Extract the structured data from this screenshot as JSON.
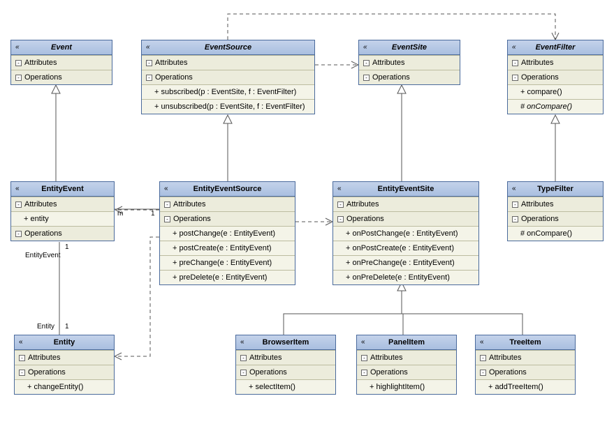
{
  "labels": {
    "attributes": "Attributes",
    "operations": "Operations"
  },
  "classes": {
    "event": {
      "name": "Event",
      "abstract": true
    },
    "eventSource": {
      "name": "EventSource",
      "abstract": true,
      "ops": [
        "+ subscribed(p : EventSite, f : EventFilter)",
        "+ unsubscribed(p : EventSite, f : EventFilter)"
      ]
    },
    "eventSite": {
      "name": "EventSite",
      "abstract": true
    },
    "eventFilter": {
      "name": "EventFilter",
      "abstract": true,
      "ops": [
        "+ compare()",
        "# onCompare()"
      ]
    },
    "entityEvent": {
      "name": "EntityEvent",
      "attrs": [
        "+ entity"
      ]
    },
    "entityEventSource": {
      "name": "EntityEventSource",
      "ops": [
        "+ postChange(e : EntityEvent)",
        "+ postCreate(e : EntityEvent)",
        "+ preChange(e : EntityEvent)",
        "+ preDelete(e : EntityEvent)"
      ]
    },
    "entityEventSite": {
      "name": "EntityEventSite",
      "ops": [
        "+ onPostChange(e : EntityEvent)",
        "+ onPostCreate(e : EntityEvent)",
        "+ onPreChange(e : EntityEvent)",
        "+ onPreDelete(e : EntityEvent)"
      ]
    },
    "typeFilter": {
      "name": "TypeFilter",
      "ops": [
        "# onCompare()"
      ]
    },
    "entity": {
      "name": "Entity",
      "ops": [
        "+ changeEntity()"
      ]
    },
    "browserItem": {
      "name": "BrowserItem",
      "ops": [
        "+ selectItem()"
      ]
    },
    "panelItem": {
      "name": "PanelItem",
      "ops": [
        "+ highlightItem()"
      ]
    },
    "treeItem": {
      "name": "TreeItem",
      "ops": [
        "+ addTreeItem()"
      ]
    }
  },
  "associations": {
    "entityevent_entity": {
      "end1_role": "EntityEvent",
      "end1_mult": "1",
      "end2_role": "Entity",
      "end2_mult": "1"
    },
    "entityevent_source": {
      "end1_mult": "m",
      "end2_mult": "1"
    }
  },
  "relationships": [
    {
      "from": "EntityEvent",
      "to": "Event",
      "kind": "generalization"
    },
    {
      "from": "EntityEventSource",
      "to": "EventSource",
      "kind": "generalization"
    },
    {
      "from": "EntityEventSite",
      "to": "EventSite",
      "kind": "generalization"
    },
    {
      "from": "TypeFilter",
      "to": "EventFilter",
      "kind": "generalization"
    },
    {
      "from": "BrowserItem",
      "to": "EntityEventSite",
      "kind": "generalization"
    },
    {
      "from": "PanelItem",
      "to": "EntityEventSite",
      "kind": "generalization"
    },
    {
      "from": "TreeItem",
      "to": "EntityEventSite",
      "kind": "generalization"
    },
    {
      "from": "EventSource",
      "to": "EventSite",
      "kind": "dependency"
    },
    {
      "from": "EventSource",
      "to": "EventFilter",
      "kind": "dependency"
    },
    {
      "from": "EntityEventSource",
      "to": "EntityEventSite",
      "kind": "dependency"
    },
    {
      "from": "EntityEventSource",
      "to": "EntityEvent",
      "kind": "dependency"
    },
    {
      "from": "EntityEventSource",
      "to": "Entity",
      "kind": "dependency"
    },
    {
      "from": "EntityEvent",
      "to": "Entity",
      "kind": "association",
      "mult": [
        "1",
        "1"
      ]
    },
    {
      "from": "EntityEvent",
      "to": "EntityEventSource",
      "kind": "association",
      "mult": [
        "m",
        "1"
      ]
    }
  ]
}
